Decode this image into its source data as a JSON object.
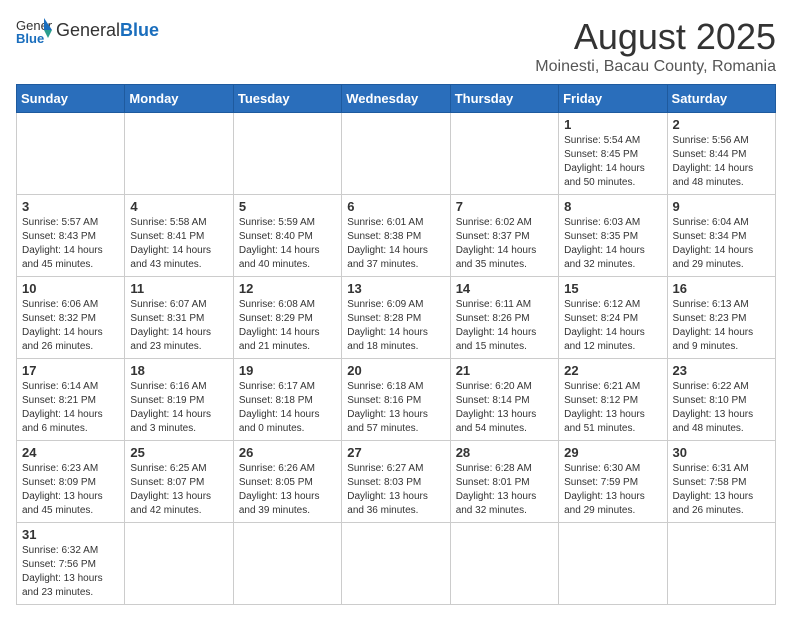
{
  "header": {
    "logo_general": "General",
    "logo_blue": "Blue",
    "title": "August 2025",
    "subtitle": "Moinesti, Bacau County, Romania"
  },
  "weekdays": [
    "Sunday",
    "Monday",
    "Tuesday",
    "Wednesday",
    "Thursday",
    "Friday",
    "Saturday"
  ],
  "weeks": [
    [
      {
        "day": "",
        "info": ""
      },
      {
        "day": "",
        "info": ""
      },
      {
        "day": "",
        "info": ""
      },
      {
        "day": "",
        "info": ""
      },
      {
        "day": "",
        "info": ""
      },
      {
        "day": "1",
        "info": "Sunrise: 5:54 AM\nSunset: 8:45 PM\nDaylight: 14 hours and 50 minutes."
      },
      {
        "day": "2",
        "info": "Sunrise: 5:56 AM\nSunset: 8:44 PM\nDaylight: 14 hours and 48 minutes."
      }
    ],
    [
      {
        "day": "3",
        "info": "Sunrise: 5:57 AM\nSunset: 8:43 PM\nDaylight: 14 hours and 45 minutes."
      },
      {
        "day": "4",
        "info": "Sunrise: 5:58 AM\nSunset: 8:41 PM\nDaylight: 14 hours and 43 minutes."
      },
      {
        "day": "5",
        "info": "Sunrise: 5:59 AM\nSunset: 8:40 PM\nDaylight: 14 hours and 40 minutes."
      },
      {
        "day": "6",
        "info": "Sunrise: 6:01 AM\nSunset: 8:38 PM\nDaylight: 14 hours and 37 minutes."
      },
      {
        "day": "7",
        "info": "Sunrise: 6:02 AM\nSunset: 8:37 PM\nDaylight: 14 hours and 35 minutes."
      },
      {
        "day": "8",
        "info": "Sunrise: 6:03 AM\nSunset: 8:35 PM\nDaylight: 14 hours and 32 minutes."
      },
      {
        "day": "9",
        "info": "Sunrise: 6:04 AM\nSunset: 8:34 PM\nDaylight: 14 hours and 29 minutes."
      }
    ],
    [
      {
        "day": "10",
        "info": "Sunrise: 6:06 AM\nSunset: 8:32 PM\nDaylight: 14 hours and 26 minutes."
      },
      {
        "day": "11",
        "info": "Sunrise: 6:07 AM\nSunset: 8:31 PM\nDaylight: 14 hours and 23 minutes."
      },
      {
        "day": "12",
        "info": "Sunrise: 6:08 AM\nSunset: 8:29 PM\nDaylight: 14 hours and 21 minutes."
      },
      {
        "day": "13",
        "info": "Sunrise: 6:09 AM\nSunset: 8:28 PM\nDaylight: 14 hours and 18 minutes."
      },
      {
        "day": "14",
        "info": "Sunrise: 6:11 AM\nSunset: 8:26 PM\nDaylight: 14 hours and 15 minutes."
      },
      {
        "day": "15",
        "info": "Sunrise: 6:12 AM\nSunset: 8:24 PM\nDaylight: 14 hours and 12 minutes."
      },
      {
        "day": "16",
        "info": "Sunrise: 6:13 AM\nSunset: 8:23 PM\nDaylight: 14 hours and 9 minutes."
      }
    ],
    [
      {
        "day": "17",
        "info": "Sunrise: 6:14 AM\nSunset: 8:21 PM\nDaylight: 14 hours and 6 minutes."
      },
      {
        "day": "18",
        "info": "Sunrise: 6:16 AM\nSunset: 8:19 PM\nDaylight: 14 hours and 3 minutes."
      },
      {
        "day": "19",
        "info": "Sunrise: 6:17 AM\nSunset: 8:18 PM\nDaylight: 14 hours and 0 minutes."
      },
      {
        "day": "20",
        "info": "Sunrise: 6:18 AM\nSunset: 8:16 PM\nDaylight: 13 hours and 57 minutes."
      },
      {
        "day": "21",
        "info": "Sunrise: 6:20 AM\nSunset: 8:14 PM\nDaylight: 13 hours and 54 minutes."
      },
      {
        "day": "22",
        "info": "Sunrise: 6:21 AM\nSunset: 8:12 PM\nDaylight: 13 hours and 51 minutes."
      },
      {
        "day": "23",
        "info": "Sunrise: 6:22 AM\nSunset: 8:10 PM\nDaylight: 13 hours and 48 minutes."
      }
    ],
    [
      {
        "day": "24",
        "info": "Sunrise: 6:23 AM\nSunset: 8:09 PM\nDaylight: 13 hours and 45 minutes."
      },
      {
        "day": "25",
        "info": "Sunrise: 6:25 AM\nSunset: 8:07 PM\nDaylight: 13 hours and 42 minutes."
      },
      {
        "day": "26",
        "info": "Sunrise: 6:26 AM\nSunset: 8:05 PM\nDaylight: 13 hours and 39 minutes."
      },
      {
        "day": "27",
        "info": "Sunrise: 6:27 AM\nSunset: 8:03 PM\nDaylight: 13 hours and 36 minutes."
      },
      {
        "day": "28",
        "info": "Sunrise: 6:28 AM\nSunset: 8:01 PM\nDaylight: 13 hours and 32 minutes."
      },
      {
        "day": "29",
        "info": "Sunrise: 6:30 AM\nSunset: 7:59 PM\nDaylight: 13 hours and 29 minutes."
      },
      {
        "day": "30",
        "info": "Sunrise: 6:31 AM\nSunset: 7:58 PM\nDaylight: 13 hours and 26 minutes."
      }
    ],
    [
      {
        "day": "31",
        "info": "Sunrise: 6:32 AM\nSunset: 7:56 PM\nDaylight: 13 hours and 23 minutes."
      },
      {
        "day": "",
        "info": ""
      },
      {
        "day": "",
        "info": ""
      },
      {
        "day": "",
        "info": ""
      },
      {
        "day": "",
        "info": ""
      },
      {
        "day": "",
        "info": ""
      },
      {
        "day": "",
        "info": ""
      }
    ]
  ]
}
